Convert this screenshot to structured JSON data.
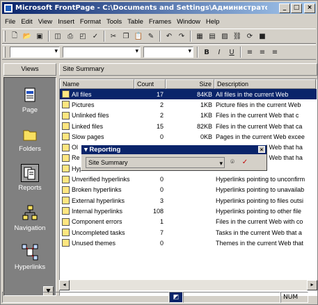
{
  "window": {
    "title": "Microsoft FrontPage - C:\\Documents and Settings\\Администратор\\Мои ..."
  },
  "menu": [
    "File",
    "Edit",
    "View",
    "Insert",
    "Format",
    "Tools",
    "Table",
    "Frames",
    "Window",
    "Help"
  ],
  "views": {
    "header": "Views",
    "items": [
      {
        "label": "Page",
        "icon": "page-view-icon"
      },
      {
        "label": "Folders",
        "icon": "folders-view-icon"
      },
      {
        "label": "Reports",
        "icon": "reports-view-icon"
      },
      {
        "label": "Navigation",
        "icon": "navigation-view-icon"
      },
      {
        "label": "Hyperlinks",
        "icon": "hyperlinks-view-icon"
      }
    ]
  },
  "main": {
    "header": "Site Summary",
    "columns": [
      "Name",
      "Count",
      "Size",
      "Description"
    ],
    "rows": [
      {
        "name": "All files",
        "count": "17",
        "size": "84KB",
        "desc": "All files in the current Web",
        "selected": true
      },
      {
        "name": "Pictures",
        "count": "2",
        "size": "1KB",
        "desc": "Picture files in the current Web"
      },
      {
        "name": "Unlinked files",
        "count": "2",
        "size": "1KB",
        "desc": "Files in the current Web that c"
      },
      {
        "name": "Linked files",
        "count": "15",
        "size": "82KB",
        "desc": "Files in the current Web that ca"
      },
      {
        "name": "Slow pages",
        "count": "0",
        "size": "0KB",
        "desc": "Pages in the current Web excee"
      },
      {
        "name": "Ol",
        "count": "",
        "size": "",
        "desc": "Files in the current Web that ha"
      },
      {
        "name": "Re",
        "count": "",
        "size": "",
        "desc": "Files in the current Web that ha"
      },
      {
        "name": "Hyperlinks",
        "count": "",
        "size": "",
        "desc": ""
      },
      {
        "name": "Unverified hyperlinks",
        "count": "0",
        "size": "",
        "desc": "Hyperlinks pointing to unconfirm"
      },
      {
        "name": "Broken hyperlinks",
        "count": "0",
        "size": "",
        "desc": "Hyperlinks pointing to unavailab"
      },
      {
        "name": "External hyperlinks",
        "count": "3",
        "size": "",
        "desc": "Hyperlinks pointing to files outsi"
      },
      {
        "name": "Internal hyperlinks",
        "count": "108",
        "size": "",
        "desc": "Hyperlinks pointing to other file"
      },
      {
        "name": "Component errors",
        "count": "1",
        "size": "",
        "desc": "Files in the current Web with co"
      },
      {
        "name": "Uncompleted tasks",
        "count": "7",
        "size": "",
        "desc": "Tasks in the current Web that a"
      },
      {
        "name": "Unused themes",
        "count": "0",
        "size": "",
        "desc": "Themes in the current Web that"
      }
    ]
  },
  "reporting": {
    "title": "Reporting",
    "selected": "Site Summary"
  },
  "status": {
    "mode": "NUM"
  }
}
